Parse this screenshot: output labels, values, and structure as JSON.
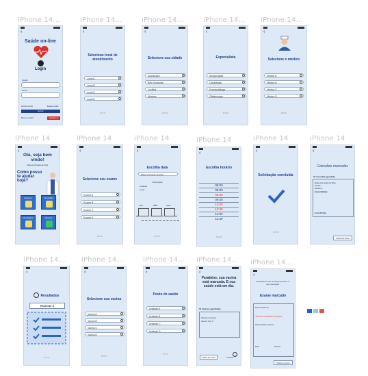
{
  "labels": {
    "row1": "iPhone 14...",
    "row2": "iPhone 14...",
    "row3": "iPhone 14..."
  },
  "row_label_full": "iPhone 14",
  "login": {
    "title": "Saúde on-line",
    "login_label": "Login",
    "user_label": "Usuário",
    "pass_label": "Senha",
    "remember": "Lembrar senha",
    "forgot": "Esqueci senha",
    "enter": "Entrar",
    "new_account": "Não tem conta?",
    "signup": "Cadastre-se"
  },
  "unit": {
    "title": "Selecione local de atendimento",
    "items": [
      "Local A",
      "Local B",
      "Local C",
      "Local D"
    ]
  },
  "city": {
    "title": "Selecione sua cidade",
    "items": [
      "Araraquara",
      "Belo Horizonte",
      "Curitiba",
      "Manaus"
    ]
  },
  "specialty": {
    "title": "Especialista",
    "items": [
      "Alergologista",
      "Cardiologia",
      "Fonoaudióloga",
      "Oftalmologia"
    ]
  },
  "doctor": {
    "title": "Selecione o médico",
    "items": [
      "Médico A",
      "Médico B",
      "Médico C",
      "Médico D"
    ]
  },
  "home": {
    "greeting": "Olá, seja bem vindo!",
    "name": "Mateus Almeida da Silva",
    "question": "Como posso te ajudar hoje?",
    "tiles": [
      "Exames",
      "Consultas",
      "Resultados",
      "Vacinas"
    ]
  },
  "exam": {
    "title": "Selecione seu exame",
    "items": [
      "Exame A",
      "Exame B",
      "Exame C",
      "Exame D"
    ]
  },
  "date": {
    "title": "Escolha data",
    "name": "Mateus Almeida da Silva",
    "info": "Informação",
    "unit": "Unidade",
    "local": "Local",
    "day": "DIA",
    "month": "MÊS",
    "year": "ANO"
  },
  "time": {
    "title": "Escolha horário",
    "times": [
      "08:00",
      "08:30",
      "09:00",
      "09:30",
      "10:00",
      "10:30",
      "11:00",
      "11:30"
    ]
  },
  "done": {
    "title": "Solicitação concluída"
  },
  "appointments": {
    "title": "Consultas marcadas",
    "subtitle": "01 Consulta agendada",
    "name": "Mateus Almeida da Silva",
    "city": "Cidade",
    "doctor": "Médico A",
    "specialty": "Especialidade",
    "date": "MAR/ABR/DEZ",
    "btn": "Voltar ao início"
  },
  "results": {
    "title": "Resultados",
    "patient": "Paciente X"
  },
  "vaccine": {
    "title": "Selecione sua vacina",
    "items": [
      "Vacina A",
      "Vacina B",
      "Vacina C",
      "Vacina D"
    ]
  },
  "health": {
    "title": "Posto de saúde",
    "items": [
      "Unidade A",
      "Unidade B",
      "Unidade C",
      "Unidade D"
    ]
  },
  "vacdone": {
    "title": "Parabéns, sua vacina está marcada. E sua saúde está em dia.",
    "sub": "01 Vacinas agendadas",
    "doses": "Número de doses",
    "tipo": "Vacina: Tipo X",
    "btn1": "Voltar ao início",
    "btn2": "Cancelar"
  },
  "examdone": {
    "top": "Enviaremos um lembrete próximo a sua marcação.",
    "title": "Exame marcado",
    "patient": "Nome exame: A",
    "warning": "*Somente resultados entregues.",
    "note": "Observações exames",
    "date": "Data",
    "time": "Horário",
    "btn": "Voltar ao início"
  },
  "colors": {
    "accent": "#1f3f8a",
    "bg": "#dde9f6",
    "tile": "#2f6ec7",
    "red": "#d9342b"
  }
}
